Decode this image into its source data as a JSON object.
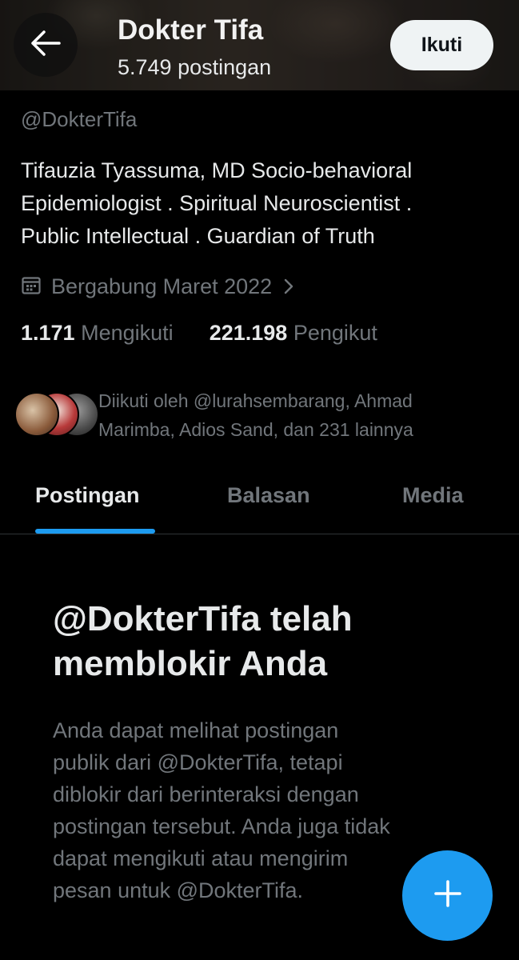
{
  "header": {
    "name": "Dokter Tifa",
    "post_count": "5.749 postingan",
    "follow_label": "Ikuti"
  },
  "profile": {
    "handle": "@DokterTifa",
    "bio_lines": [
      "Tifauzia Tyassuma, MD Socio-behavioral",
      "Epidemiologist .  Spiritual Neuroscientist .",
      "Public Intellectual . Guardian of Truth"
    ],
    "joined": "Bergabung Maret 2022",
    "following_count": "1.171",
    "following_label": "Mengikuti",
    "followers_count": "221.198",
    "followers_label": "Pengikut",
    "followed_by_lines": [
      "Diikuti oleh @lurahsembarang, Ahmad",
      "Marimba, Adios Sand, dan 231 lainnya"
    ]
  },
  "tabs": [
    {
      "label": "Postingan",
      "active": true
    },
    {
      "label": "Balasan",
      "active": false
    },
    {
      "label": "Media",
      "active": false
    }
  ],
  "blocked_notice": {
    "title_lines": [
      "@DokterTifa telah",
      "memblokir Anda"
    ],
    "description_lines": [
      "Anda dapat melihat postingan",
      "publik dari @DokterTifa, tetapi",
      "diblokir dari berinteraksi dengan",
      "postingan tersebut. Anda juga tidak",
      "dapat mengikuti atau mengirim",
      "pesan untuk @DokterTifa."
    ]
  },
  "icons": {
    "back": "arrow-left-icon",
    "calendar": "calendar-icon",
    "chevron": "chevron-right-icon",
    "compose": "plus-icon"
  },
  "colors": {
    "accent": "#1d9bf0",
    "background": "#000000",
    "text_primary": "#e7e9ea",
    "text_secondary": "#71767b"
  }
}
